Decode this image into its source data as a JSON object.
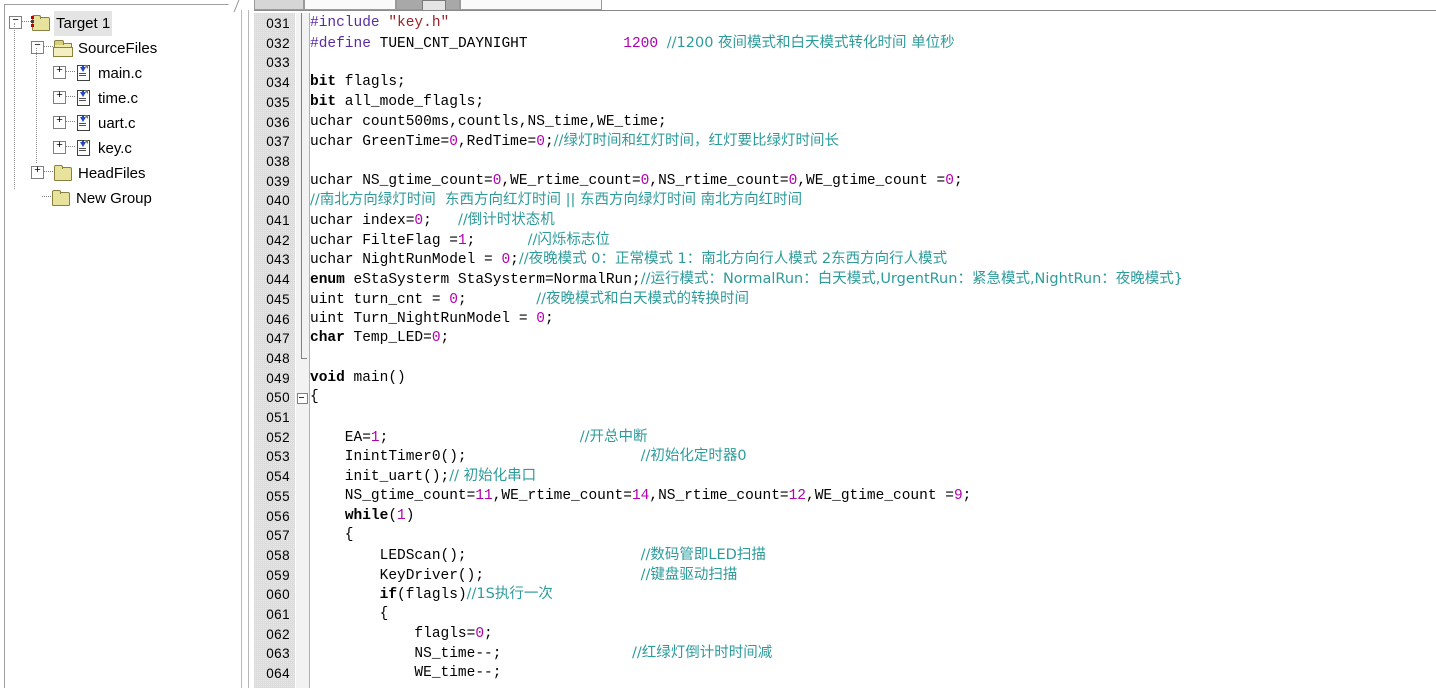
{
  "project_tree": {
    "root_label": "Target 1",
    "items": [
      {
        "label": "Target 1",
        "icon": "target-folder-icon",
        "depth": 0,
        "expander": "minus",
        "selected": true
      },
      {
        "label": "SourceFiles",
        "icon": "open-folder-icon",
        "depth": 1,
        "expander": "minus",
        "selected": false
      },
      {
        "label": "main.c",
        "icon": "c-file-icon",
        "depth": 2,
        "expander": "plus",
        "selected": false
      },
      {
        "label": "time.c",
        "icon": "c-file-icon",
        "depth": 2,
        "expander": "plus",
        "selected": false
      },
      {
        "label": "uart.c",
        "icon": "c-file-icon",
        "depth": 2,
        "expander": "plus",
        "selected": false
      },
      {
        "label": "key.c",
        "icon": "c-file-icon",
        "depth": 2,
        "expander": "plus",
        "selected": false
      },
      {
        "label": "HeadFiles",
        "icon": "folder-icon",
        "depth": 1,
        "expander": "plus",
        "selected": false
      },
      {
        "label": "New Group",
        "icon": "folder-icon",
        "depth": 1,
        "expander": "none",
        "selected": false
      }
    ]
  },
  "editor": {
    "first_line_number": 31,
    "gutter_width_digits": 3,
    "fold_markers": [
      {
        "line": 50,
        "type": "collapse-box"
      }
    ],
    "colors": {
      "preprocessor": "#5a2ca0",
      "string": "#9b2226",
      "keyword": "#000000",
      "number": "#b000b0",
      "comment": "#2e9b9b",
      "plain": "#000000",
      "gutter_bg": "#e9e9e9",
      "background": "#ffffff"
    },
    "lines": [
      {
        "n": "031",
        "tokens": [
          {
            "t": "#include ",
            "c": "pre"
          },
          {
            "t": "\"key.h\"",
            "c": "str"
          }
        ]
      },
      {
        "n": "032",
        "tokens": [
          {
            "t": "#define ",
            "c": "pre"
          },
          {
            "t": "TUEN_CNT_DAYNIGHT           ",
            "c": "txt"
          },
          {
            "t": "1200 ",
            "c": "num"
          },
          {
            "t": "//1200 夜间模式和白天模式转化时间 单位秒",
            "c": "cmt"
          }
        ]
      },
      {
        "n": "033",
        "tokens": []
      },
      {
        "n": "034",
        "tokens": [
          {
            "t": "bit",
            "c": "kw"
          },
          {
            "t": " flagls;",
            "c": "txt"
          }
        ]
      },
      {
        "n": "035",
        "tokens": [
          {
            "t": "bit",
            "c": "kw"
          },
          {
            "t": " all_mode_flagls;",
            "c": "txt"
          }
        ]
      },
      {
        "n": "036",
        "tokens": [
          {
            "t": "uchar count500ms,countls,NS_time,WE_time;",
            "c": "txt"
          }
        ]
      },
      {
        "n": "037",
        "tokens": [
          {
            "t": "uchar GreenTime=",
            "c": "txt"
          },
          {
            "t": "0",
            "c": "num"
          },
          {
            "t": ",RedTime=",
            "c": "txt"
          },
          {
            "t": "0",
            "c": "num"
          },
          {
            "t": ";",
            "c": "txt"
          },
          {
            "t": "//绿灯时间和红灯时间，红灯要比绿灯时间长",
            "c": "cmt"
          }
        ]
      },
      {
        "n": "038",
        "tokens": []
      },
      {
        "n": "039",
        "tokens": [
          {
            "t": "uchar NS_gtime_count=",
            "c": "txt"
          },
          {
            "t": "0",
            "c": "num"
          },
          {
            "t": ",WE_rtime_count=",
            "c": "txt"
          },
          {
            "t": "0",
            "c": "num"
          },
          {
            "t": ",NS_rtime_count=",
            "c": "txt"
          },
          {
            "t": "0",
            "c": "num"
          },
          {
            "t": ",WE_gtime_count =",
            "c": "txt"
          },
          {
            "t": "0",
            "c": "num"
          },
          {
            "t": ";",
            "c": "txt"
          }
        ]
      },
      {
        "n": "040",
        "tokens": [
          {
            "t": "//南北方向绿灯时间  东西方向红灯时间 || 东西方向绿灯时间 南北方向红时间",
            "c": "cmt"
          }
        ]
      },
      {
        "n": "041",
        "tokens": [
          {
            "t": "uchar index=",
            "c": "txt"
          },
          {
            "t": "0",
            "c": "num"
          },
          {
            "t": ";   ",
            "c": "txt"
          },
          {
            "t": "//倒计时状态机",
            "c": "cmt"
          }
        ]
      },
      {
        "n": "042",
        "tokens": [
          {
            "t": "uchar FilteFlag =",
            "c": "txt"
          },
          {
            "t": "1",
            "c": "num"
          },
          {
            "t": ";      ",
            "c": "txt"
          },
          {
            "t": "//闪烁标志位",
            "c": "cmt"
          }
        ]
      },
      {
        "n": "043",
        "tokens": [
          {
            "t": "uchar NightRunModel = ",
            "c": "txt"
          },
          {
            "t": "0",
            "c": "num"
          },
          {
            "t": ";",
            "c": "txt"
          },
          {
            "t": "//夜晚模式 0：正常模式 1：南北方向行人模式 2东西方向行人模式",
            "c": "cmt"
          }
        ]
      },
      {
        "n": "044",
        "tokens": [
          {
            "t": "enum",
            "c": "kw"
          },
          {
            "t": " eStaSysterm StaSysterm=NormalRun;",
            "c": "txt"
          },
          {
            "t": "//运行模式：NormalRun：白天模式,UrgentRun：紧急模式,NightRun：夜晚模式}",
            "c": "cmt"
          }
        ]
      },
      {
        "n": "045",
        "tokens": [
          {
            "t": "uint turn_cnt = ",
            "c": "txt"
          },
          {
            "t": "0",
            "c": "num"
          },
          {
            "t": ";        ",
            "c": "txt"
          },
          {
            "t": "//夜晚模式和白天模式的转换时间",
            "c": "cmt"
          }
        ]
      },
      {
        "n": "046",
        "tokens": [
          {
            "t": "uint Turn_NightRunModel = ",
            "c": "txt"
          },
          {
            "t": "0",
            "c": "num"
          },
          {
            "t": ";",
            "c": "txt"
          }
        ]
      },
      {
        "n": "047",
        "tokens": [
          {
            "t": "char",
            "c": "kw"
          },
          {
            "t": " Temp_LED=",
            "c": "txt"
          },
          {
            "t": "0",
            "c": "num"
          },
          {
            "t": ";",
            "c": "txt"
          }
        ]
      },
      {
        "n": "048",
        "tokens": []
      },
      {
        "n": "049",
        "tokens": [
          {
            "t": "void",
            "c": "kw"
          },
          {
            "t": " main()",
            "c": "txt"
          }
        ]
      },
      {
        "n": "050",
        "tokens": [
          {
            "t": "{",
            "c": "txt"
          }
        ]
      },
      {
        "n": "051",
        "tokens": []
      },
      {
        "n": "052",
        "tokens": [
          {
            "t": "    EA=",
            "c": "txt"
          },
          {
            "t": "1",
            "c": "num"
          },
          {
            "t": ";                      ",
            "c": "txt"
          },
          {
            "t": "//开总中断",
            "c": "cmt"
          }
        ]
      },
      {
        "n": "053",
        "tokens": [
          {
            "t": "    InintTimer0();                    ",
            "c": "txt"
          },
          {
            "t": "//初始化定时器0",
            "c": "cmt"
          }
        ]
      },
      {
        "n": "054",
        "tokens": [
          {
            "t": "    init_uart();",
            "c": "txt"
          },
          {
            "t": "// 初始化串口",
            "c": "cmt"
          }
        ]
      },
      {
        "n": "055",
        "tokens": [
          {
            "t": "    NS_gtime_count=",
            "c": "txt"
          },
          {
            "t": "11",
            "c": "num"
          },
          {
            "t": ",WE_rtime_count=",
            "c": "txt"
          },
          {
            "t": "14",
            "c": "num"
          },
          {
            "t": ",NS_rtime_count=",
            "c": "txt"
          },
          {
            "t": "12",
            "c": "num"
          },
          {
            "t": ",WE_gtime_count =",
            "c": "txt"
          },
          {
            "t": "9",
            "c": "num"
          },
          {
            "t": ";",
            "c": "txt"
          }
        ]
      },
      {
        "n": "056",
        "tokens": [
          {
            "t": "    ",
            "c": "txt"
          },
          {
            "t": "while",
            "c": "kw"
          },
          {
            "t": "(",
            "c": "txt"
          },
          {
            "t": "1",
            "c": "num"
          },
          {
            "t": ")",
            "c": "txt"
          }
        ]
      },
      {
        "n": "057",
        "tokens": [
          {
            "t": "    {",
            "c": "txt"
          }
        ]
      },
      {
        "n": "058",
        "tokens": [
          {
            "t": "        LEDScan();                    ",
            "c": "txt"
          },
          {
            "t": "//数码管即LED扫描",
            "c": "cmt"
          }
        ]
      },
      {
        "n": "059",
        "tokens": [
          {
            "t": "        KeyDriver();                  ",
            "c": "txt"
          },
          {
            "t": "//键盘驱动扫描",
            "c": "cmt"
          }
        ]
      },
      {
        "n": "060",
        "tokens": [
          {
            "t": "        ",
            "c": "txt"
          },
          {
            "t": "if",
            "c": "kw"
          },
          {
            "t": "(flagls)",
            "c": "txt"
          },
          {
            "t": "//1S执行一次",
            "c": "cmt"
          }
        ]
      },
      {
        "n": "061",
        "tokens": [
          {
            "t": "        {",
            "c": "txt"
          }
        ]
      },
      {
        "n": "062",
        "tokens": [
          {
            "t": "            flagls=",
            "c": "txt"
          },
          {
            "t": "0",
            "c": "num"
          },
          {
            "t": ";",
            "c": "txt"
          }
        ]
      },
      {
        "n": "063",
        "tokens": [
          {
            "t": "            NS_time--;               ",
            "c": "txt"
          },
          {
            "t": "//红绿灯倒计时时间减",
            "c": "cmt"
          }
        ]
      },
      {
        "n": "064",
        "tokens": [
          {
            "t": "            WE_time--;",
            "c": "txt"
          }
        ]
      }
    ]
  }
}
